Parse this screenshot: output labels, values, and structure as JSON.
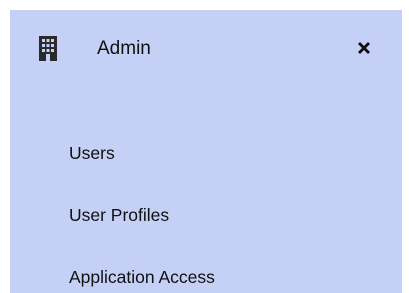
{
  "header": {
    "icon": "building-icon",
    "title": "Admin",
    "close_icon": "close-icon"
  },
  "menu": {
    "items": [
      {
        "label": "Users"
      },
      {
        "label": "User Profiles"
      },
      {
        "label": "Application Access"
      }
    ]
  },
  "colors": {
    "panel_background": "#c4d0f5",
    "text": "#111111",
    "icon": "#2a2a2a"
  }
}
